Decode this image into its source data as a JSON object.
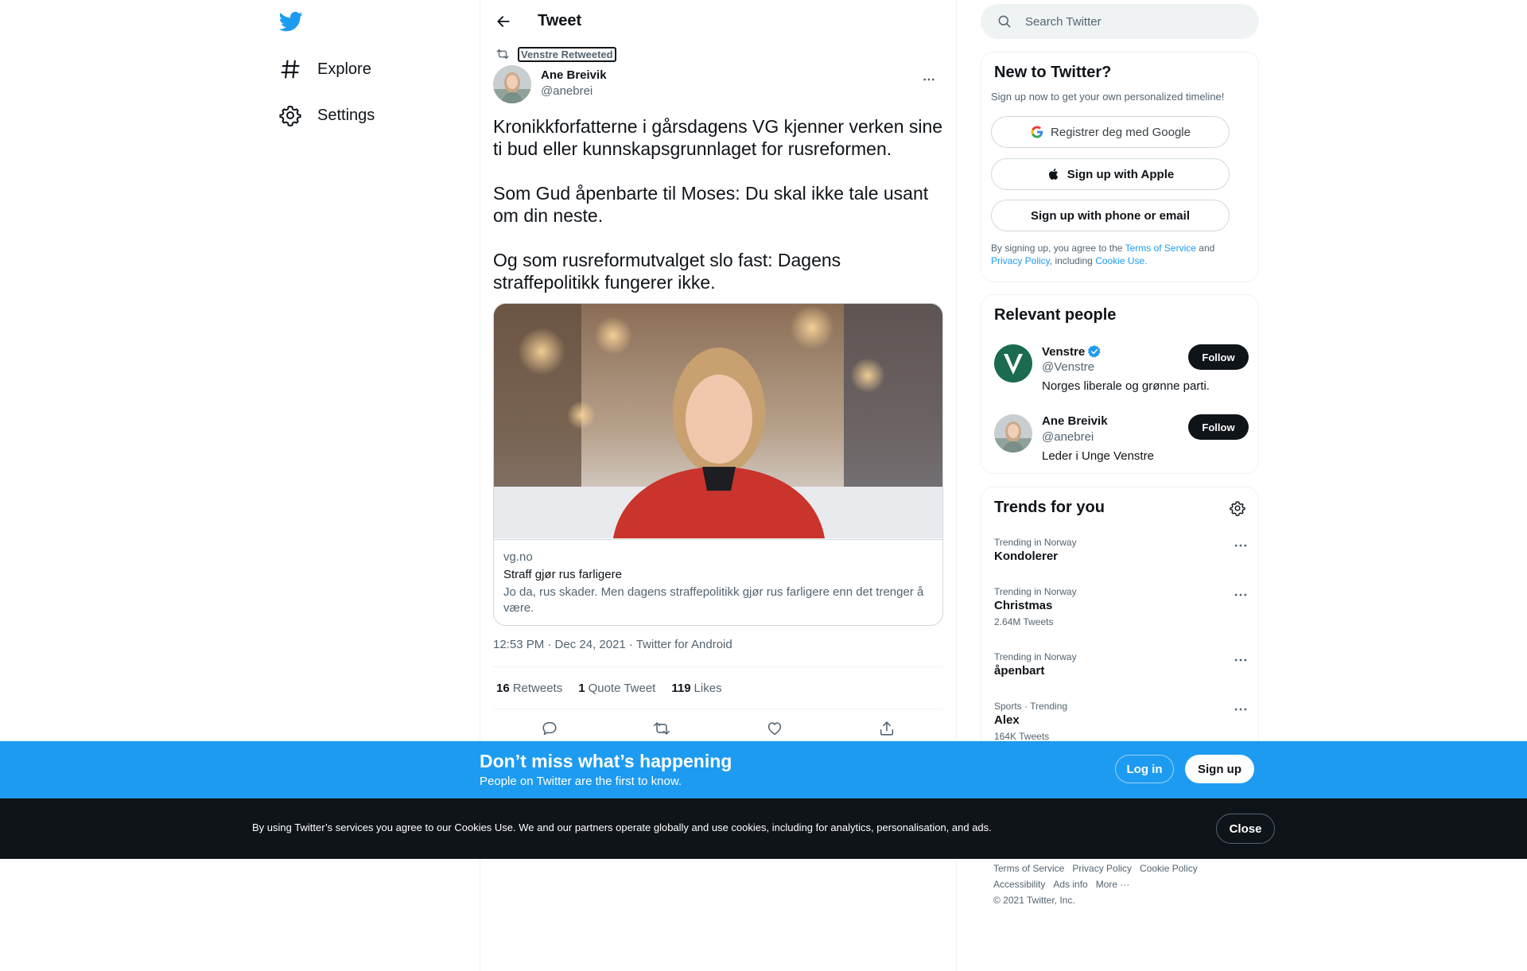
{
  "nav": {
    "logo": "twitter-bird-icon",
    "items": [
      {
        "label": "Explore",
        "icon": "hashtag-icon"
      },
      {
        "label": "Settings",
        "icon": "gear-icon"
      }
    ]
  },
  "header": {
    "title": "Tweet"
  },
  "tweet": {
    "retweeted_by": "Venstre Retweeted",
    "author_name": "Ane Breivik",
    "author_handle": "@anebrei",
    "paragraphs": [
      "Kronikkforfatterne i gårsdagens VG kjenner verken sine ti bud eller kunnskapsgrunnlaget for rusreformen.",
      "Som Gud åpenbarte til Moses: Du skal ikke tale usant om din neste.",
      "Og som rusreformutvalget slo fast: Dagens straffepolitikk fungerer ikke."
    ],
    "card": {
      "domain": "vg.no",
      "title": "Straff gjør rus farligere",
      "description": "Jo da, rus skader. Men dagens straffepolitikk gjør rus farligere enn det trenger å være."
    },
    "timestamp": "12:53 PM · Dec 24, 2021 · Twitter for Android",
    "stats": [
      {
        "count": "16",
        "label": "Retweets"
      },
      {
        "count": "1",
        "label": "Quote Tweet"
      },
      {
        "count": "119",
        "label": "Likes"
      }
    ]
  },
  "search": {
    "placeholder": "Search Twitter"
  },
  "new_to_twitter": {
    "title": "New to Twitter?",
    "subtitle": "Sign up now to get your own personalized timeline!",
    "google_label": "Registrer deg med Google",
    "apple_label": "Sign up with Apple",
    "phone_label": "Sign up with phone or email",
    "legal_prefix": "By signing up, you agree to the",
    "terms": "Terms of Service",
    "and": "and",
    "privacy": "Privacy Policy",
    "including": ", including",
    "cookie": "Cookie Use."
  },
  "relevant_people": {
    "title": "Relevant people",
    "people": [
      {
        "name": "Venstre",
        "handle": "@Venstre",
        "bio": "Norges liberale og grønne parti.",
        "follow": "Follow"
      },
      {
        "name": "Ane Breivik",
        "handle": "@anebrei",
        "bio": "Leder i Unge Venstre",
        "follow": "Follow"
      }
    ]
  },
  "trends": {
    "title": "Trends for you",
    "items": [
      {
        "context": "Trending in Norway",
        "name": "Kondolerer",
        "count": ""
      },
      {
        "context": "Trending in Norway",
        "name": "Christmas",
        "count": "2.64M Tweets"
      },
      {
        "context": "Trending in Norway",
        "name": "åpenbart",
        "count": ""
      },
      {
        "context": "Sports · Trending",
        "name": "Alex",
        "count": "164K Tweets"
      }
    ]
  },
  "footer": {
    "links": [
      "Terms of Service",
      "Privacy Policy",
      "Cookie Policy",
      "Accessibility",
      "Ads info",
      "More ···"
    ],
    "copyright": "© 2021 Twitter, Inc."
  },
  "bottom_bar": {
    "title": "Don’t miss what’s happening",
    "subtitle": "People on Twitter are the first to know.",
    "login": "Log in",
    "signup": "Sign up"
  },
  "cookie_bar": {
    "text": "By using Twitter’s services you agree to our Cookies Use. We and our partners operate globally and use cookies, including for analytics, personalisation, and ads.",
    "close": "Close"
  },
  "colors": {
    "brand": "#1d9bf0",
    "text": "#0f1419",
    "secondary": "#536471",
    "dark_bar": "#0f1419"
  }
}
